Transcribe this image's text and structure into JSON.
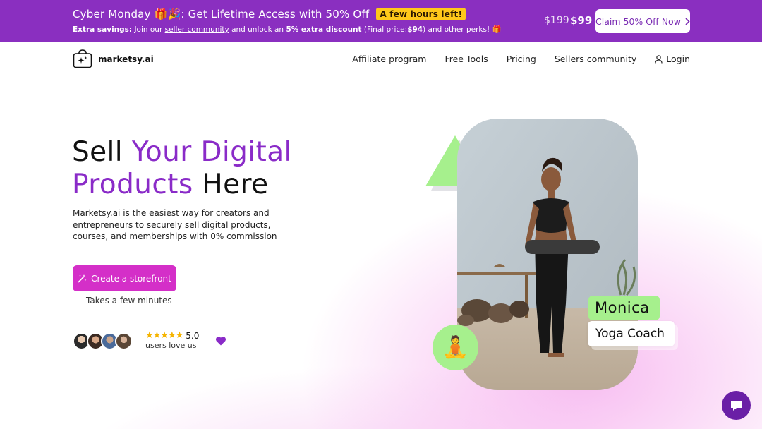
{
  "promo": {
    "title": "Cyber Monday 🎁🎉: Get Lifetime Access with 50% Off",
    "badge": "A few hours left!",
    "sub_label": "Extra savings:",
    "sub_text1": "Join our",
    "sub_link": "seller community",
    "sub_text2": "and unlock an",
    "sub_bold": "5% extra discount",
    "sub_text3": "(Final price:",
    "sub_price": "$94",
    "sub_text4": ") and other perks! 🎁",
    "old_price": "$199",
    "new_price": "$99",
    "claim_label": "Claim 50% Off Now"
  },
  "nav": {
    "logo_text": "marketsy.ai",
    "links": [
      "Affiliate program",
      "Free Tools",
      "Pricing",
      "Sellers community"
    ],
    "login": "Login"
  },
  "hero": {
    "title_w1": "Sell",
    "title_w2": "Your Digital",
    "title_w3": "Products",
    "title_w4": "Here",
    "description": "Marketsy.ai is the easiest way for creators and entrepreneurs to securely sell digital products, courses, and memberships with 0% commission",
    "cta_label": "Create a storefront",
    "cta_note": "Takes a few minutes",
    "rating": "5.0",
    "rating_text": "users love us"
  },
  "visual": {
    "name": "Monica",
    "role": "Yoga Coach",
    "yoga_emoji": "🧘"
  },
  "colors": {
    "promo_bg": "#8a2fc0",
    "accent_purple": "#8a2bc8",
    "cta_pink": "#d42fc8",
    "green": "#a6f08d",
    "badge_yellow": "#ffc81a"
  }
}
